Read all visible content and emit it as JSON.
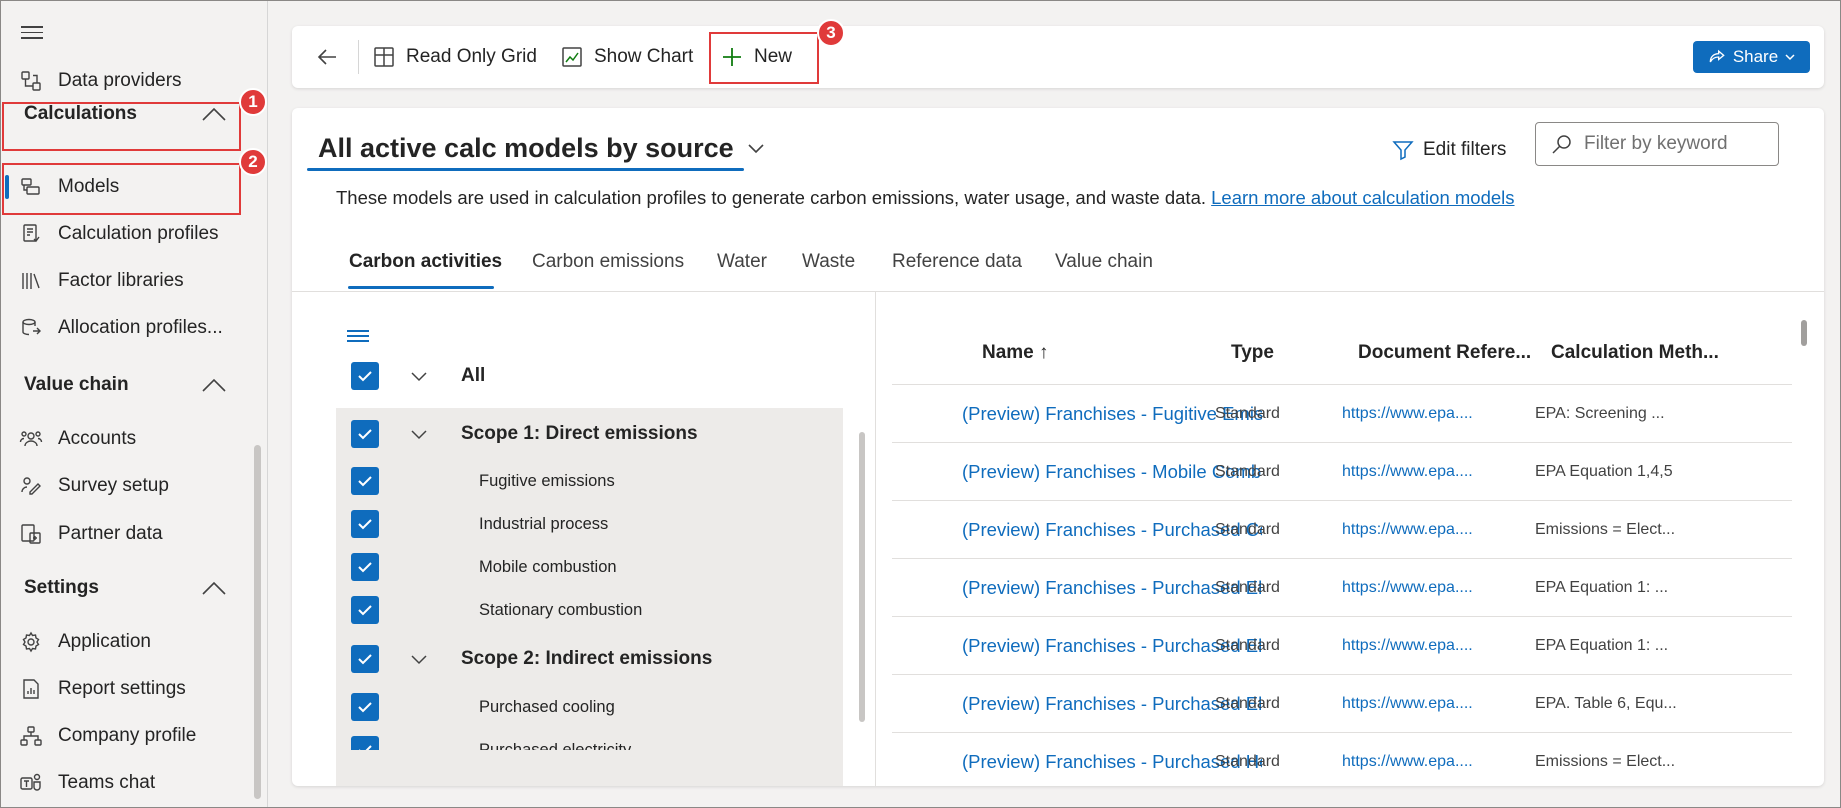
{
  "sidebar": {
    "top_items": [
      {
        "label": "Data providers",
        "icon": "data-providers-icon"
      }
    ],
    "calculations": {
      "title": "Calculations",
      "items": [
        {
          "label": "Models",
          "icon": "models-icon",
          "active": true
        },
        {
          "label": "Calculation profiles",
          "icon": "calculation-profiles-icon"
        },
        {
          "label": "Factor libraries",
          "icon": "factor-libraries-icon"
        },
        {
          "label": "Allocation profiles...",
          "icon": "allocation-profiles-icon"
        }
      ]
    },
    "value_chain": {
      "title": "Value chain",
      "items": [
        {
          "label": "Accounts",
          "icon": "accounts-icon"
        },
        {
          "label": "Survey setup",
          "icon": "survey-setup-icon"
        },
        {
          "label": "Partner data",
          "icon": "partner-data-icon"
        }
      ]
    },
    "settings": {
      "title": "Settings",
      "items": [
        {
          "label": "Application",
          "icon": "application-gear-icon"
        },
        {
          "label": "Report settings",
          "icon": "report-settings-icon"
        },
        {
          "label": "Company profile",
          "icon": "company-profile-icon"
        },
        {
          "label": "Teams chat",
          "icon": "teams-chat-icon"
        }
      ]
    }
  },
  "annotations": {
    "badge1": "1",
    "badge2": "2",
    "badge3": "3"
  },
  "commandbar": {
    "read_only_grid": "Read Only Grid",
    "show_chart": "Show Chart",
    "new": "New",
    "share": "Share"
  },
  "view": {
    "title": "All active calc models by source",
    "edit_filters": "Edit filters",
    "search_placeholder": "Filter by keyword",
    "description": "These models are used in calculation profiles to generate carbon emissions, water usage, and waste data.",
    "learn_more": "Learn more about calculation models"
  },
  "tabs": [
    "Carbon activities",
    "Carbon emissions",
    "Water",
    "Waste",
    "Reference data",
    "Value chain"
  ],
  "tree": {
    "all": "All",
    "scope1": "Scope 1: Direct emissions",
    "scope1_items": [
      "Fugitive emissions",
      "Industrial process",
      "Mobile combustion",
      "Stationary combustion"
    ],
    "scope2": "Scope 2: Indirect emissions",
    "scope2_items": [
      "Purchased cooling",
      "Purchased electricity"
    ]
  },
  "grid": {
    "headers": {
      "name": "Name ↑",
      "type": "Type",
      "doc": "Document Refere...",
      "calc": "Calculation Meth..."
    },
    "rows": [
      {
        "name": "(Preview) Franchises - Fugitive Emiss",
        "type": "Standard",
        "doc": "https://www.epa....",
        "calc": "EPA: Screening ..."
      },
      {
        "name": "(Preview) Franchises - Mobile Comb",
        "type": "Standard",
        "doc": "https://www.epa....",
        "calc": "EPA Equation 1,4,5"
      },
      {
        "name": "(Preview) Franchises - Purchased Co",
        "type": "Standard",
        "doc": "https://www.epa....",
        "calc": "Emissions = Elect..."
      },
      {
        "name": "(Preview) Franchises - Purchased Ele",
        "type": "Standard",
        "doc": "https://www.epa....",
        "calc": "EPA Equation 1: ..."
      },
      {
        "name": "(Preview) Franchises - Purchased Ele",
        "type": "Standard",
        "doc": "https://www.epa....",
        "calc": "EPA Equation 1: ..."
      },
      {
        "name": "(Preview) Franchises - Purchased Ele",
        "type": "Standard",
        "doc": "https://www.epa....",
        "calc": "EPA. Table 6, Equ..."
      },
      {
        "name": "(Preview) Franchises - Purchased He",
        "type": "Standard",
        "doc": "https://www.epa....",
        "calc": "Emissions = Elect..."
      }
    ]
  },
  "colors": {
    "accent": "#0f6cbd",
    "annotation": "#e03a3a",
    "new_icon": "#107c10"
  }
}
